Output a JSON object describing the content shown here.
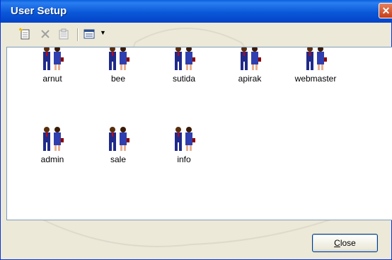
{
  "window": {
    "title": "User Setup",
    "close_glyph": "✕"
  },
  "toolbar": {
    "buttons": [
      {
        "icon": "new-user-icon"
      },
      {
        "icon": "delete-icon"
      },
      {
        "icon": "properties-icon"
      },
      {
        "icon": "view-menu-icon"
      }
    ]
  },
  "users": [
    {
      "label": "arnut"
    },
    {
      "label": "bee"
    },
    {
      "label": "sutida"
    },
    {
      "label": "apirak"
    },
    {
      "label": "webmaster"
    },
    {
      "label": "admin"
    },
    {
      "label": "sale"
    },
    {
      "label": "info"
    }
  ],
  "footer": {
    "close_mnemonic": "C",
    "close_rest": "lose"
  },
  "colors": {
    "title_bar": "#0a58d8",
    "dialog_bg": "#ece9d8",
    "list_bg": "#ffffff"
  }
}
